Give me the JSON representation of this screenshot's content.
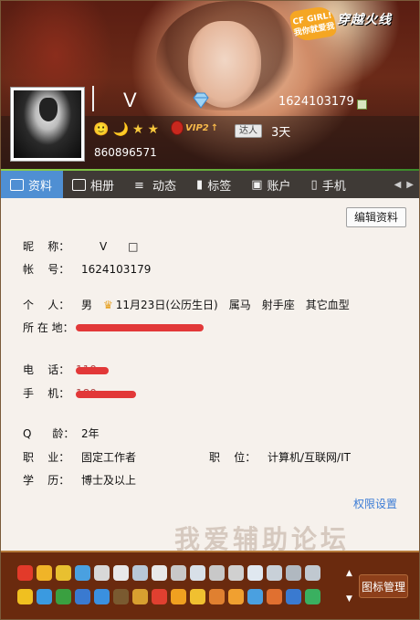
{
  "header": {
    "nickname": "V",
    "qq_number": "1624103179",
    "alt_number": "860896571",
    "cf_badge": "CF GIRL!\n我你就爱我",
    "cf_logo": "穿越火线",
    "vip_label": "VIP2",
    "daren_label": "达人",
    "daren_days": "3天",
    "level_icons": [
      "🙂",
      "🌙",
      "★",
      "★"
    ]
  },
  "tabs": [
    {
      "label": "资料",
      "active": true
    },
    {
      "label": "相册",
      "active": false
    },
    {
      "label": "动态",
      "active": false
    },
    {
      "label": "标签",
      "active": false
    },
    {
      "label": "账户",
      "active": false
    },
    {
      "label": "手机",
      "active": false
    }
  ],
  "profile": {
    "edit_button": "编辑资料",
    "nickname_label": "昵    称：",
    "nickname_value": "V      □",
    "account_label": "帐    号：",
    "account_value": "1624103179",
    "personal_label": "个    人：",
    "gender": "男",
    "birthday": "11月23日(公历生日)",
    "zodiac": "属马",
    "star_sign": "射手座",
    "blood_type": "其它血型",
    "location_label": "所 在 地：",
    "phone_label": "电    话：",
    "phone_value": "110",
    "mobile_label": "手    机：",
    "mobile_value": "180",
    "age_label": "Q      龄：",
    "age_value": "2年",
    "job_label": "职    业：",
    "job_value": "固定工作者",
    "position_label": "职    位：",
    "position_value": "计算机/互联网/IT",
    "education_label": "学    历：",
    "education_value": "博士及以上",
    "permission_link": "权限设置",
    "watermark": "我爱辅助论坛"
  },
  "iconbar": {
    "manage_label": "图标管理",
    "row1_colors": [
      "#e23a2a",
      "#f0b428",
      "#e8c030",
      "#4aa0e0",
      "#d8d8d8",
      "#e8e8e8",
      "#b8c8d8",
      "#e8e8e8",
      "#c8c8c8",
      "#d8e0e8",
      "#c8c8c8",
      "#d0d0d0",
      "#e0e8f0",
      "#c8d0d8",
      "#b0b8c0",
      "#c0c8d0"
    ],
    "row2_colors": [
      "#f0c020",
      "#3a9ae0",
      "#3aa040",
      "#3a7ad0",
      "#3a90e0",
      "#7a5a30",
      "#d8a030",
      "#e04030",
      "#f0a020",
      "#f0c030",
      "#e08030",
      "#f0a030",
      "#4aa0e0",
      "#e07030",
      "#3a7ad0",
      "#3ab060"
    ]
  }
}
